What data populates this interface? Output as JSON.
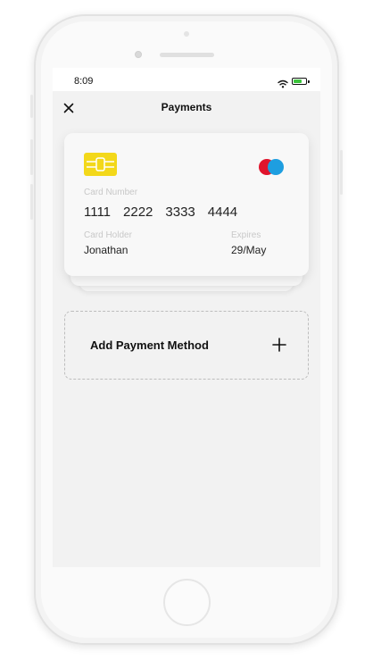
{
  "status_bar": {
    "time": "8:09"
  },
  "nav": {
    "title": "Payments",
    "close_icon": "close-icon"
  },
  "card": {
    "number_label": "Card Number",
    "number_groups": [
      "1111",
      "2222",
      "3333",
      "4444"
    ],
    "holder_label": "Card Holder",
    "holder_value": "Jonathan",
    "expires_label": "Expires",
    "expires_value": "29/May",
    "chip_color": "#f3d81a",
    "brand_colors": [
      "#e0142c",
      "#1e9ee0"
    ]
  },
  "add_payment": {
    "label": "Add Payment Method",
    "icon": "plus-icon"
  }
}
